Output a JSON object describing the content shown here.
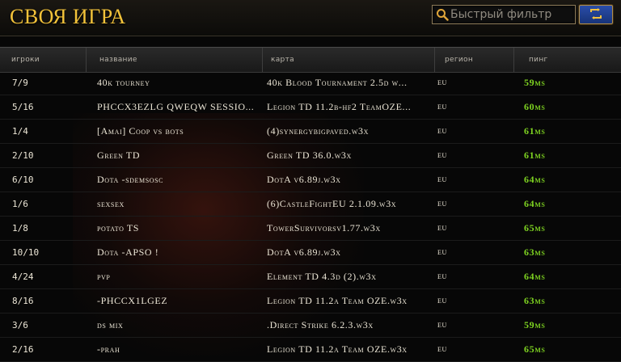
{
  "title": "СВОЯ ИГРА",
  "filter": {
    "placeholder": "Быстрый фильтр"
  },
  "columns": {
    "players": "игроки",
    "name": "название",
    "map": "карта",
    "region": "регион",
    "ping": "пинг"
  },
  "colors": {
    "title": "#f2c23a",
    "ping": "#7ed321",
    "refresh_button": "#1f3f96"
  },
  "icons": {
    "search": "search-icon",
    "refresh": "refresh-icon"
  },
  "games": [
    {
      "players": "7/9",
      "name": "40k tourney",
      "map": "40k Blood Tournament 2.5d w...",
      "region": "eu",
      "ping": "59ms"
    },
    {
      "players": "5/16",
      "name": "PHCCX3EZLG QWEQW SESSIO...",
      "map": "Legion TD 11.2b-hf2 TeamOZE...",
      "region": "eu",
      "ping": "60ms"
    },
    {
      "players": "1/4",
      "name": "[Amai] Coop vs bots",
      "map": "(4)synergybigpaved.w3x",
      "region": "eu",
      "ping": "61ms"
    },
    {
      "players": "2/10",
      "name": "Green TD",
      "map": "Green TD 36.0.w3x",
      "region": "eu",
      "ping": "61ms"
    },
    {
      "players": "6/10",
      "name": "Dota -sdemsosc",
      "map": "DotA v6.89j.w3x",
      "region": "eu",
      "ping": "64ms"
    },
    {
      "players": "1/6",
      "name": "sexsex",
      "map": "(6)CastleFightEU 2.1.09.w3x",
      "region": "eu",
      "ping": "64ms"
    },
    {
      "players": "1/8",
      "name": "potato TS",
      "map": "TowerSurvivorsv1.77.w3x",
      "region": "eu",
      "ping": "65ms"
    },
    {
      "players": "10/10",
      "name": "Dota -APSO !",
      "map": "DotA v6.89j.w3x",
      "region": "eu",
      "ping": "63ms"
    },
    {
      "players": "4/24",
      "name": "pvp",
      "map": "Element TD 4.3d (2).w3x",
      "region": "eu",
      "ping": "64ms"
    },
    {
      "players": "8/16",
      "name": "-PHCCX1LGEZ",
      "map": "Legion TD 11.2a Team OZE.w3x",
      "region": "eu",
      "ping": "63ms"
    },
    {
      "players": "3/6",
      "name": "ds mix",
      "map": ".Direct Strike 6.2.3.w3x",
      "region": "eu",
      "ping": "59ms"
    },
    {
      "players": "2/16",
      "name": "-prah",
      "map": "Legion TD 11.2a Team OZE.w3x",
      "region": "eu",
      "ping": "65ms"
    }
  ]
}
